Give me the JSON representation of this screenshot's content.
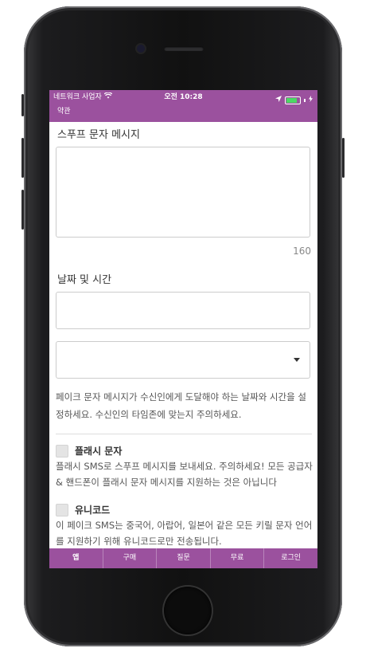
{
  "status": {
    "carrier": "네트워크 사업자",
    "time": "오전 10:28"
  },
  "navbar": {
    "title": "약관"
  },
  "form": {
    "message_label": "스푸프 문자 메시지",
    "message_value": "",
    "char_count": "160",
    "datetime_label": "날짜 및 시간",
    "date_value": "",
    "time_select_value": "",
    "datetime_help": "페이크 문자 메시지가 수신인에게 도달해야 하는 날짜와 시간을 설정하세요. 수신인의 타임존에 맞는지 주의하세요.",
    "flash": {
      "label": "플래시 문자",
      "checked": false,
      "description": "플래시 SMS로 스푸프 메시지를 보내세요. 주의하세요! 모든 공급자 & 핸드폰이 플래시 문자 메시지를 지원하는 것은 아닙니다"
    },
    "unicode": {
      "label": "유니코드",
      "checked": false,
      "description": "이 페이크 SMS는 중국어, 아랍어, 일본어 같은 모든 키릴 문자 언어를 지원하기 위해 유니코드로만 전송됩니다."
    }
  },
  "tabbar": {
    "items": [
      {
        "label": "앱"
      },
      {
        "label": "구매"
      },
      {
        "label": "질문"
      },
      {
        "label": "무료"
      },
      {
        "label": "로그인"
      }
    ]
  },
  "colors": {
    "accent": "#9b519e",
    "battery": "#4cd964"
  },
  "icons": [
    "wifi-icon",
    "location-arrow-icon",
    "battery-icon",
    "charging-bolt-icon",
    "dropdown-caret-icon"
  ]
}
